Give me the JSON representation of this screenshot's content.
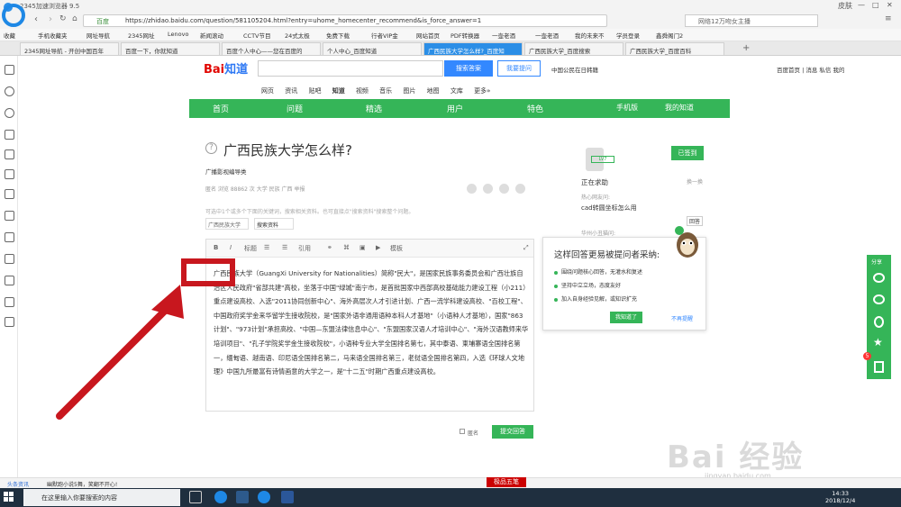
{
  "browser": {
    "window_title": "2345加速浏览器 9.5",
    "window_controls": [
      "皮肤",
      "—",
      "□",
      "✕"
    ],
    "url_secure_label": "百度",
    "url": "https://zhidao.baidu.com/question/581105204.html?entry=uhome_homecenter_recommend&is_force_answer=1",
    "search_placeholder": "网络12万吻女主播",
    "bookmarks": [
      "收藏",
      "手机收藏夹",
      "网址导航",
      "2345网址",
      "Lenovo",
      "新闻滚动",
      "CCTV节目",
      "24式太极",
      "免费下载",
      "行者VIP金",
      "网站首页",
      "PDF转换器",
      "一壶老酒",
      "一壶老酒",
      "我的未来不",
      "学员登录",
      "鑫舜阁门2"
    ],
    "tabs": [
      "2345网址导航 - 开创中国百年",
      "百度一下，你就知道",
      "百度个人中心——您在百度的",
      "个人中心_百度知道",
      "广西民族大学怎么样?_百度知",
      "广西民族大学_百度搜索",
      "广西民族大学_百度百科"
    ],
    "active_tab_index": 4,
    "new_tab": "+"
  },
  "header": {
    "logo_bai": "Bai",
    "logo_du": "知道",
    "search_button": "搜索答案",
    "ask_button": "我要提问",
    "top_link": "中国公民在日韩籍",
    "right_links": "百度首页 | 消息 私信 我的"
  },
  "channels": [
    "网页",
    "资讯",
    "贴吧",
    "知道",
    "视频",
    "音乐",
    "图片",
    "地图",
    "文库",
    "更多»"
  ],
  "greenbar": [
    "首页",
    "问题",
    "精选",
    "用户",
    "特色",
    "手机版",
    "我的知道"
  ],
  "question": {
    "title": "广西民族大学怎么样?",
    "description": "广播影视编导类",
    "meta": "匿名  浏览 88862 次  大学  民族  广西  举报",
    "hint": "可选中1个或多个下面的关键词，搜索相关资料。也可直接点\"搜索资料\"搜索整个问题。",
    "tag": "广西民族大学",
    "search_btn": "搜索资料"
  },
  "editor": {
    "toolbar": [
      "B",
      "I",
      "标题",
      "引用",
      "模板"
    ],
    "answer_text": "广西民族大学（GuangXi University for Nationalities）简称\"民大\"，是国家民族事务委员会和广西壮族自治区人民政府\"省部共建\"高校，坐落于中国\"绿城\"南宁市，是首批国家中西部高校基础能力建设工程（小211）重点建设高校、入选\"2011协同创新中心\"、海外高层次人才引进计划、广西一流学科建设高校、\"百校工程\"、中国政府奖学金来华留学生接收院校，是\"国家外语非通用语种本科人才基地\"（小语种人才基地），国家\"863计划\"、\"973计划\"承担高校、\"中国—东盟法律信息中心\"、\"东盟国家汉语人才培训中心\"、\"海外汉语教师来华培训项目\"、\"孔子学院奖学金生接收院校\"，小语种专业大学全国排名第七，其中泰语、柬埔寨语全国排名第一，缅甸语、越南语、印尼语全国排名第二，马来语全国排名第三，老挝语全国排名第四，入选《环球人文地理》中国九所最富有诗情画意的大学之一，是\"十二五\"时期广西重点建设高校。",
    "anonymous": "匿名",
    "submit": "提交回答"
  },
  "sidebar": {
    "sign_button": "已签到",
    "level": "LV7",
    "seeking": "正在求助",
    "swap": "换一换",
    "hot_label": "热心网友问:",
    "hot_question": "cad转圆坐标怎么用",
    "user2": "华州小丑猫问:",
    "answer_tag": "回答"
  },
  "tip": {
    "title": "这样回答更易被提问者采纳:",
    "items": [
      "围绕问题核心回答，无灌水和复述",
      "坚持中立立场，态度友好",
      "加入自身经验见解，或知识扩充"
    ],
    "know": "我知道了",
    "no_remind": "不再提醒"
  },
  "share": {
    "label": "分享",
    "badge": "5"
  },
  "statusbar": {
    "left": "头条资讯",
    "news": "幽默跑小说5舞，笑翻不开心!"
  },
  "ime": "极品五笔",
  "taskbar": {
    "search": "在这里输入你要搜索的内容",
    "time": "14:33",
    "date": "2018/12/4"
  },
  "watermark": "Bai 经验",
  "watermark_url": "jingyan.baidu.com",
  "colors": {
    "green": "#35b558",
    "blue": "#3388ff",
    "red_annotation": "#c8171e"
  }
}
